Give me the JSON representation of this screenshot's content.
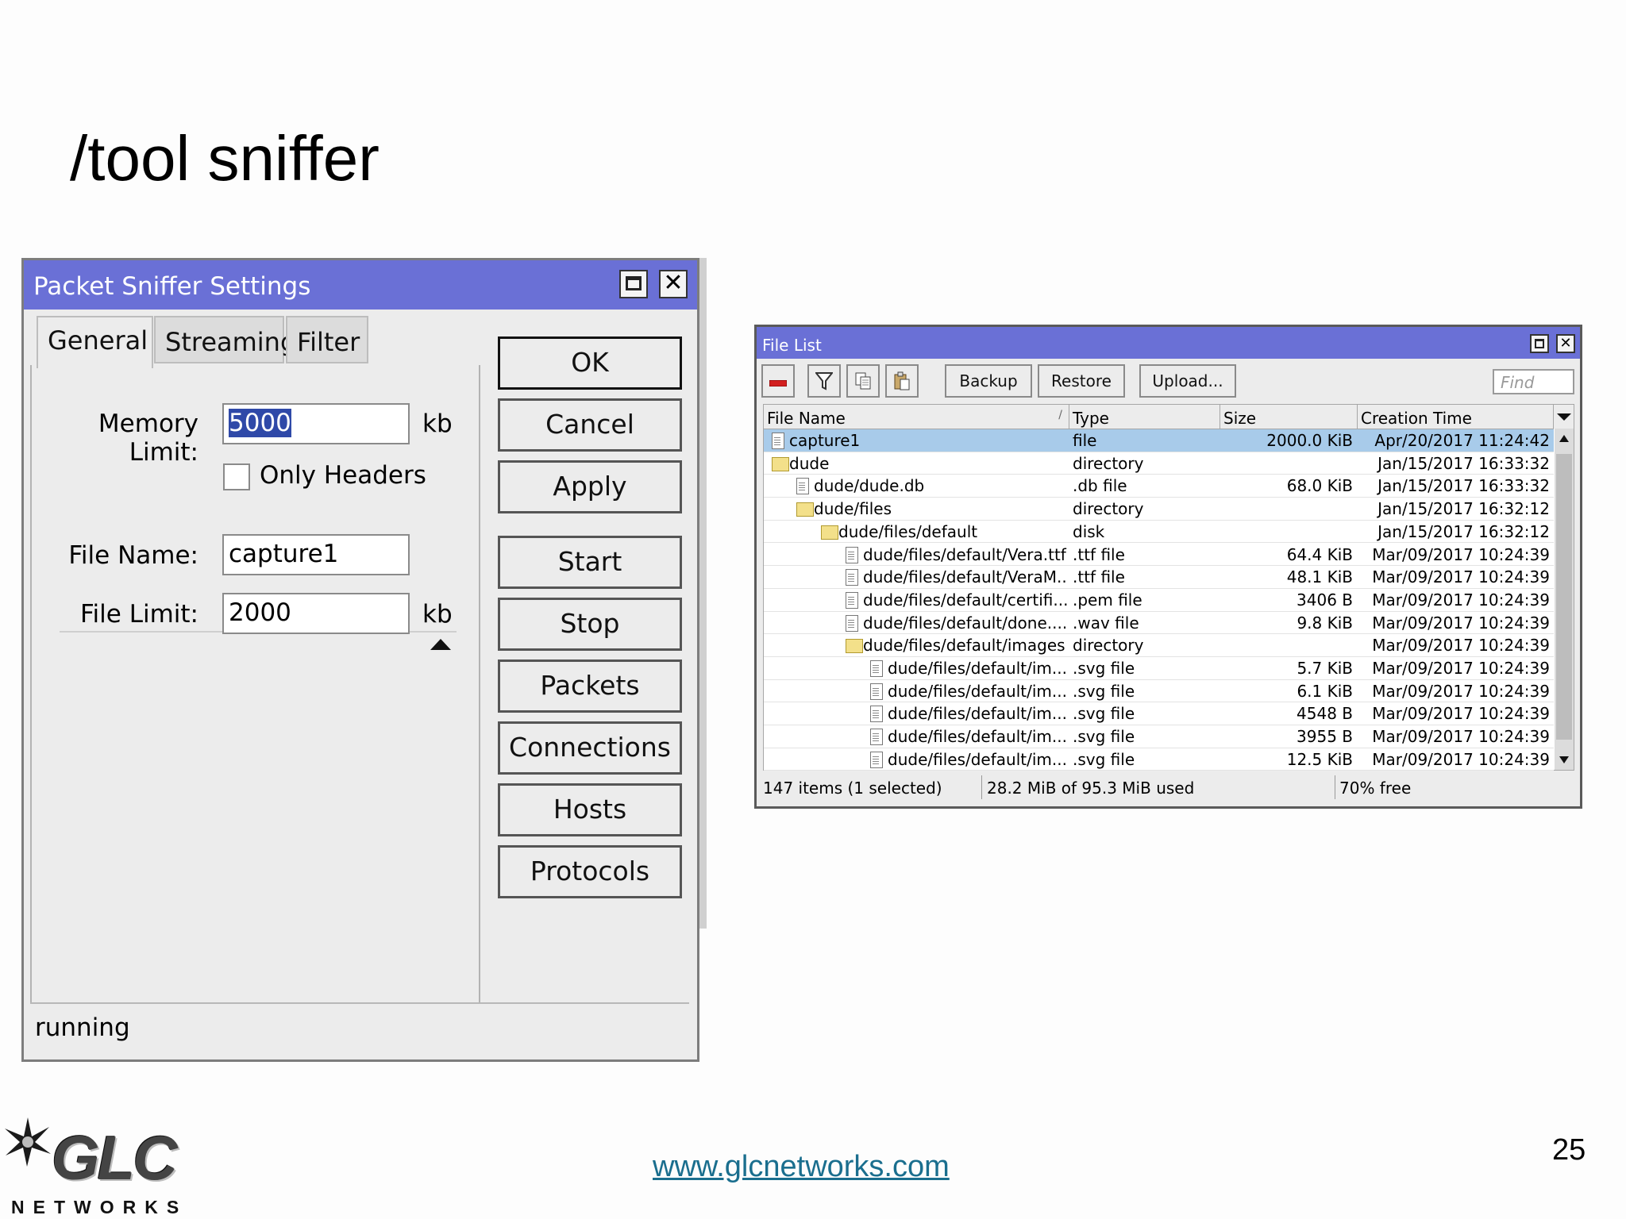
{
  "slide": {
    "title": "/tool sniffer",
    "footer_link": "www.glcnetworks.com",
    "page_number": "25",
    "logo_text": "GLC",
    "logo_subtext": "NETWORKS"
  },
  "sniffer": {
    "title": "Packet Sniffer Settings",
    "tabs": [
      "General",
      "Streaming",
      "Filter"
    ],
    "memory_limit_label": "Memory Limit:",
    "memory_limit_value": "5000",
    "memory_limit_unit": "kb",
    "only_headers_label": "Only Headers",
    "only_headers_checked": false,
    "file_name_label": "File Name:",
    "file_name_value": "capture1",
    "file_limit_label": "File Limit:",
    "file_limit_value": "2000",
    "file_limit_unit": "kb",
    "buttons": [
      "OK",
      "Cancel",
      "Apply",
      "Start",
      "Stop",
      "Packets",
      "Connections",
      "Hosts",
      "Protocols"
    ],
    "status": "running",
    "colors": {
      "titlebar": "#6a70d6",
      "selection": "#2f49a8"
    }
  },
  "filelist": {
    "title": "File List",
    "toolbar": {
      "backup": "Backup",
      "restore": "Restore",
      "upload": "Upload...",
      "find_placeholder": "Find"
    },
    "columns": [
      "File Name",
      "Type",
      "Size",
      "Creation Time"
    ],
    "rows": [
      {
        "name": "capture1",
        "type": "file",
        "size": "2000.0 KiB",
        "time": "Apr/20/2017 11:24:42",
        "icon": "file-icon",
        "depth": 0,
        "selected": true
      },
      {
        "name": "dude",
        "type": "directory",
        "size": "",
        "time": "Jan/15/2017 16:33:32",
        "icon": "folder-icon",
        "depth": 0
      },
      {
        "name": "dude/dude.db",
        "type": ".db file",
        "size": "68.0 KiB",
        "time": "Jan/15/2017 16:33:32",
        "icon": "file-icon",
        "depth": 1
      },
      {
        "name": "dude/files",
        "type": "directory",
        "size": "",
        "time": "Jan/15/2017 16:32:12",
        "icon": "folder-icon",
        "depth": 1
      },
      {
        "name": "dude/files/default",
        "type": "disk",
        "size": "",
        "time": "Jan/15/2017 16:32:12",
        "icon": "folder-icon",
        "depth": 2
      },
      {
        "name": "dude/files/default/Vera.ttf",
        "type": ".ttf file",
        "size": "64.4 KiB",
        "time": "Mar/09/2017 10:24:39",
        "icon": "file-icon",
        "depth": 3
      },
      {
        "name": "dude/files/default/VeraM...",
        "type": ".ttf file",
        "size": "48.1 KiB",
        "time": "Mar/09/2017 10:24:39",
        "icon": "file-icon",
        "depth": 3
      },
      {
        "name": "dude/files/default/certifi...",
        "type": ".pem file",
        "size": "3406 B",
        "time": "Mar/09/2017 10:24:39",
        "icon": "file-icon",
        "depth": 3
      },
      {
        "name": "dude/files/default/done....",
        "type": ".wav file",
        "size": "9.8 KiB",
        "time": "Mar/09/2017 10:24:39",
        "icon": "file-icon",
        "depth": 3
      },
      {
        "name": "dude/files/default/images",
        "type": "directory",
        "size": "",
        "time": "Mar/09/2017 10:24:39",
        "icon": "folder-icon",
        "depth": 3
      },
      {
        "name": "dude/files/default/im...",
        "type": ".svg file",
        "size": "5.7 KiB",
        "time": "Mar/09/2017 10:24:39",
        "icon": "file-icon",
        "depth": 4
      },
      {
        "name": "dude/files/default/im...",
        "type": ".svg file",
        "size": "6.1 KiB",
        "time": "Mar/09/2017 10:24:39",
        "icon": "file-icon",
        "depth": 4
      },
      {
        "name": "dude/files/default/im...",
        "type": ".svg file",
        "size": "4548 B",
        "time": "Mar/09/2017 10:24:39",
        "icon": "file-icon",
        "depth": 4
      },
      {
        "name": "dude/files/default/im...",
        "type": ".svg file",
        "size": "3955 B",
        "time": "Mar/09/2017 10:24:39",
        "icon": "file-icon",
        "depth": 4
      },
      {
        "name": "dude/files/default/im...",
        "type": ".svg file",
        "size": "12.5 KiB",
        "time": "Mar/09/2017 10:24:39",
        "icon": "file-icon",
        "depth": 4
      }
    ],
    "status": {
      "items": "147 items (1 selected)",
      "used": "28.2 MiB of 95.3 MiB used",
      "free": "70% free"
    },
    "colors": {
      "titlebar": "#6a70d6",
      "selected_row": "#a8cbea"
    }
  }
}
